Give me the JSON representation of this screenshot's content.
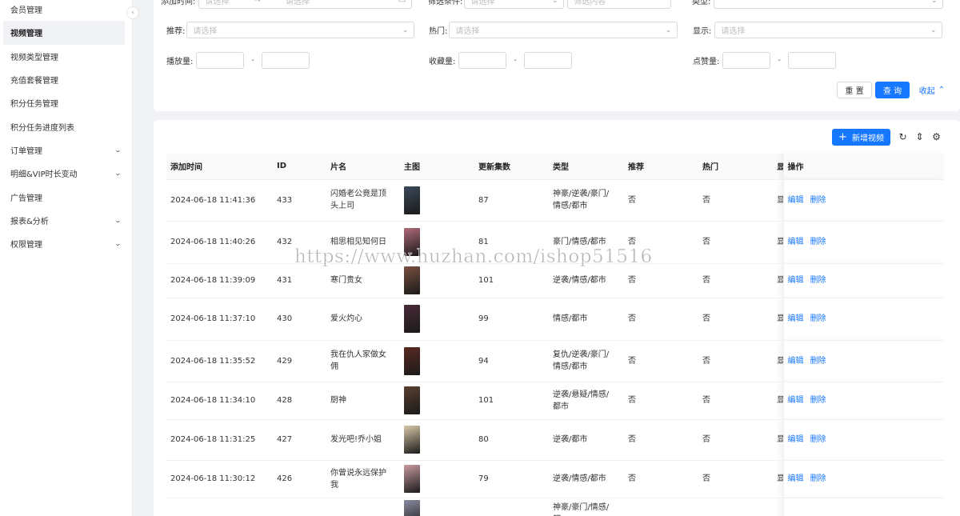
{
  "sidebar": {
    "items": [
      {
        "label": "会员管理",
        "chevron": false
      },
      {
        "label": "视频管理",
        "chevron": false,
        "active": true
      },
      {
        "label": "视频类型管理",
        "chevron": false
      },
      {
        "label": "充值套餐管理",
        "chevron": false
      },
      {
        "label": "积分任务管理",
        "chevron": false
      },
      {
        "label": "积分任务进度列表",
        "chevron": false
      },
      {
        "label": "订单管理",
        "chevron": true
      },
      {
        "label": "明细&VIP时长变动",
        "chevron": true
      },
      {
        "label": "广告管理",
        "chevron": false
      },
      {
        "label": "报表&分析",
        "chevron": true
      },
      {
        "label": "权限管理",
        "chevron": true
      }
    ],
    "chevron_glyph": "⌄",
    "collapse_glyph": "‹"
  },
  "filters": {
    "add_time_label": "添加时间:",
    "add_time_start_placeholder": "请选择",
    "add_time_arrow": "→",
    "add_time_end_placeholder": "请选择",
    "filter_cond_label": "筛选条件:",
    "filter_cond_placeholder": "请选择",
    "filter_content_placeholder": "筛选内容",
    "type_label": "类型:",
    "recommend_label": "推荐:",
    "recommend_placeholder": "请选择",
    "hot_label": "热门:",
    "hot_placeholder": "请选择",
    "show_label": "显示:",
    "show_placeholder": "请选择",
    "plays_label": "播放量:",
    "favorites_label": "收藏量:",
    "likes_label": "点赞量:",
    "range_dash": "-",
    "reset_label": "重 置",
    "query_label": "查 询",
    "collapse_label": "收起"
  },
  "toolbar": {
    "add_label": "新增视频",
    "add_icon": "+",
    "refresh_icon": "↻",
    "density_icon": "⇕",
    "settings_icon": "⚙"
  },
  "table": {
    "columns": [
      "添加时间",
      "ID",
      "片名",
      "主图",
      "更新集数",
      "类型",
      "推荐",
      "热门",
      "显",
      "操作"
    ],
    "edit_label": "编辑",
    "delete_label": "删除",
    "rows": [
      {
        "time": "2024-06-18 11:41:36",
        "id": "433",
        "title": "闪婚老公竟是顶头上司",
        "episodes": "87",
        "type": "神豪/逆袭/豪门/情感/都市",
        "recommend": "否",
        "hot": "否",
        "show": "显",
        "thumb": "#3a4a5a"
      },
      {
        "time": "2024-06-18 11:40:26",
        "id": "432",
        "title": "相思相见知何日",
        "episodes": "81",
        "type": "豪门/情感/都市",
        "recommend": "否",
        "hot": "否",
        "show": "显",
        "thumb": "#b06a7a"
      },
      {
        "time": "2024-06-18 11:39:09",
        "id": "431",
        "title": "寒门贵女",
        "episodes": "101",
        "type": "逆袭/情感/都市",
        "recommend": "否",
        "hot": "否",
        "show": "显",
        "thumb": "#7a5040"
      },
      {
        "time": "2024-06-18 11:37:10",
        "id": "430",
        "title": "爱火灼心",
        "episodes": "99",
        "type": "情感/都市",
        "recommend": "否",
        "hot": "否",
        "show": "显",
        "thumb": "#4a2a38"
      },
      {
        "time": "2024-06-18 11:35:52",
        "id": "429",
        "title": "我在仇人家做女佣",
        "episodes": "94",
        "type": "复仇/逆袭/豪门/情感/都市",
        "recommend": "否",
        "hot": "否",
        "show": "显",
        "thumb": "#5a2a22"
      },
      {
        "time": "2024-06-18 11:34:10",
        "id": "428",
        "title": "厨神",
        "episodes": "101",
        "type": "逆袭/悬疑/情感/都市",
        "recommend": "否",
        "hot": "否",
        "show": "显",
        "thumb": "#5a4030"
      },
      {
        "time": "2024-06-18 11:31:25",
        "id": "427",
        "title": "发光吧!乔小姐",
        "episodes": "80",
        "type": "逆袭/都市",
        "recommend": "否",
        "hot": "否",
        "show": "显",
        "thumb": "#d8c8a8"
      },
      {
        "time": "2024-06-18 11:30:12",
        "id": "426",
        "title": "你曾说永远保护我",
        "episodes": "79",
        "type": "逆袭/情感/都市",
        "recommend": "否",
        "hot": "否",
        "show": "显",
        "thumb": "#c89aa0"
      },
      {
        "time": "",
        "id": "",
        "title": "",
        "episodes": "",
        "type": "神豪/豪门/情感/都",
        "recommend": "",
        "hot": "",
        "show": "",
        "thumb": "#8a8aa0"
      }
    ]
  },
  "watermark": "https://www.huzhan.com/ishop51516",
  "colors": {
    "primary": "#1677ff"
  }
}
